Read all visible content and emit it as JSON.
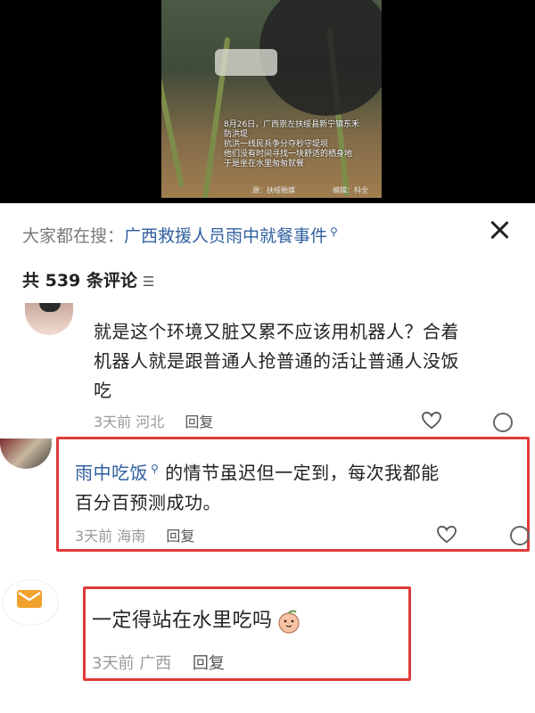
{
  "video": {
    "caption": [
      "8月26日，广西崇左扶绥县新宁镇东禾防洪堤",
      "抗洪一线民兵争分夺秒守堤坝",
      "他们没有时间寻找一块舒适的栖身地",
      "于是坐在水里匆匆就餐"
    ],
    "credit_left": "源：扶绥融媒",
    "credit_right": "编辑：科全"
  },
  "search": {
    "prefix": "大家都在搜：",
    "query": "广西救援人员雨中就餐事件"
  },
  "comments_header": {
    "count_label": "共 539 条评论",
    "sort_icon": "sort-icon"
  },
  "comments": [
    {
      "text_lines": [
        "就是这个环境又脏又累不应该用机器人？合着",
        "机器人就是跟普通人抢普通的活让普通人没饭",
        "吃"
      ],
      "time": "3天前",
      "location": "河北",
      "reply": "回复"
    },
    {
      "mention": "雨中吃饭",
      "text_line1": "的情节虽迟但一定到，每次我都能",
      "text_line2": "百分百预测成功。",
      "time": "3天前",
      "location": "海南",
      "reply": "回复"
    },
    {
      "text": "一定得站在水里吃吗",
      "time": "3天前",
      "location": "广西",
      "reply": "回复"
    }
  ],
  "colors": {
    "link": "#2f5fa0",
    "highlight": "#e03a3a"
  }
}
